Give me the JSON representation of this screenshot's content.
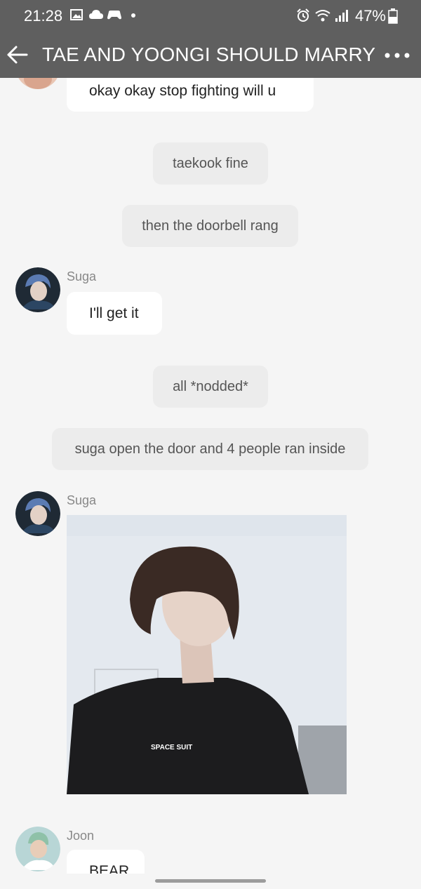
{
  "status_bar": {
    "time": "21:28",
    "battery": "47%"
  },
  "header": {
    "title": "TAE AND YOONGI SHOULD MARRY"
  },
  "messages": [
    {
      "text": "okay okay stop fighting will u"
    },
    {
      "narration": "taekook fine"
    },
    {
      "narration": "then the doorbell rang"
    },
    {
      "sender": "Suga",
      "text": "I'll get it"
    },
    {
      "narration": "all *nodded*"
    },
    {
      "narration": "suga open the door and 4 people ran inside"
    },
    {
      "sender": "Suga",
      "image_shirt_text": "SPACE SUIT"
    },
    {
      "sender": "Joon",
      "text": "BEAR"
    }
  ],
  "colors": {
    "header_bg": "#5f5f5f",
    "chat_bg": "#f5f5f5",
    "bubble_bg": "#ffffff",
    "narration_bg": "#ececec"
  }
}
